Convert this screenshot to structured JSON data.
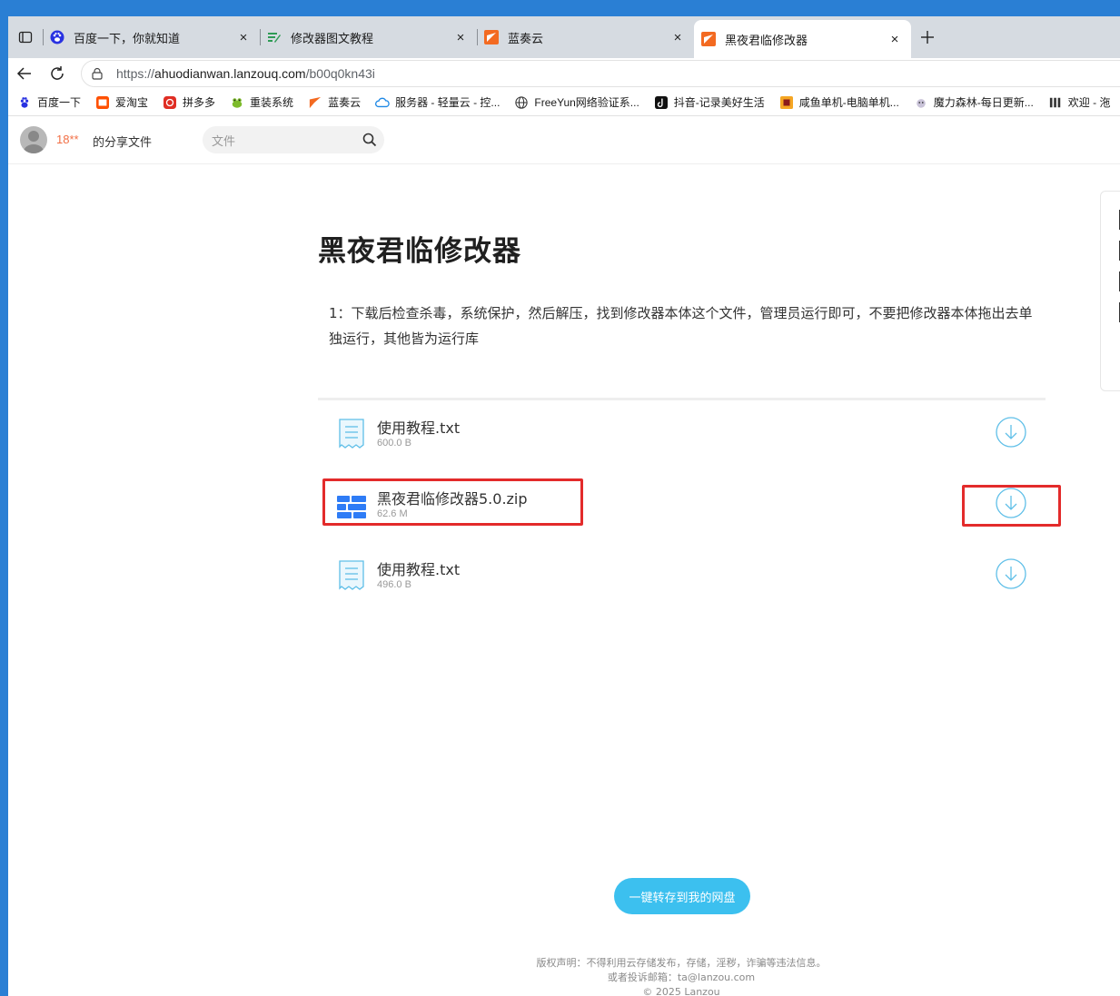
{
  "browser": {
    "tabs": [
      {
        "title": "百度一下，你就知道",
        "icon": "baidu-paw-icon",
        "active": false
      },
      {
        "title": "修改器图文教程",
        "icon": "green-edit-icon",
        "active": false
      },
      {
        "title": "蓝奏云",
        "icon": "lanzou-icon",
        "active": false
      },
      {
        "title": "黑夜君临修改器",
        "icon": "lanzou-icon",
        "active": true
      }
    ],
    "close_glyph": "×",
    "url_scheme": "https://",
    "url_host": "ahuodianwan.lanzouq.com",
    "url_path": "/b00q0kn43i"
  },
  "bookmarks": [
    {
      "label": "百度一下",
      "icon": "baidu-paw-icon"
    },
    {
      "label": "爱淘宝",
      "icon": "taobao-icon"
    },
    {
      "label": "拼多多",
      "icon": "pinduoduo-icon"
    },
    {
      "label": "重装系统",
      "icon": "frog-icon"
    },
    {
      "label": "蓝奏云",
      "icon": "lanzou-icon"
    },
    {
      "label": "服务器 - 轻量云 - 控...",
      "icon": "cloud-icon"
    },
    {
      "label": "FreeYun网络验证系...",
      "icon": "globe-icon"
    },
    {
      "label": "抖音-记录美好生活",
      "icon": "douyin-icon"
    },
    {
      "label": "咸鱼单机-电脑单机...",
      "icon": "xianyu-icon"
    },
    {
      "label": "魔力森林-每日更新...",
      "icon": "moli-icon"
    },
    {
      "label": "欢迎 - 沲",
      "icon": "welcome-icon"
    }
  ],
  "header": {
    "owner_name": "18**",
    "owner_suffix": "的分享文件",
    "search_placeholder": "文件"
  },
  "folder": {
    "title": "黑夜君临修改器",
    "description": "1：下载后检查杀毒，系统保护，然后解压，找到修改器本体这个文件，管理员运行即可，不要把修改器本体拖出去单独运行，其他皆为运行库"
  },
  "files": [
    {
      "name": "使用教程.txt",
      "size": "600.0 B",
      "type": "txt"
    },
    {
      "name": "黑夜君临修改器5.0.zip",
      "size": "62.6 M",
      "type": "zip"
    },
    {
      "name": "使用教程.txt",
      "size": "496.0 B",
      "type": "txt"
    }
  ],
  "save_button": "一键转存到我的网盘",
  "footer": {
    "line1": "版权声明：不得利用云存储发布，存储，淫秽，诈骗等违法信息。",
    "line2": "或者投诉邮箱：ta@lanzou.com",
    "line3": "© 2025 Lanzou"
  },
  "colors": {
    "accent": "#3cc0ef",
    "owner": "#f26f45",
    "highlight": "#e32b2b"
  }
}
